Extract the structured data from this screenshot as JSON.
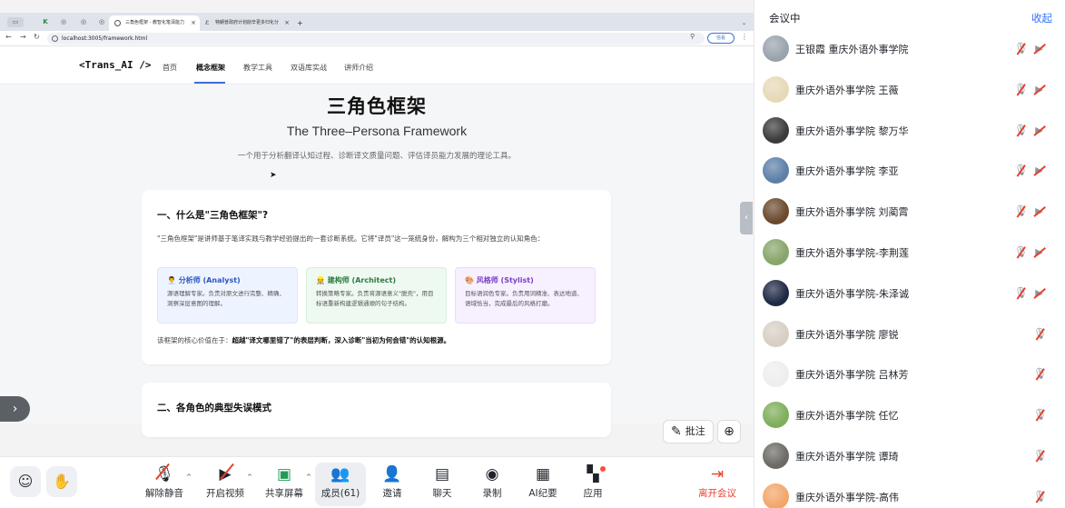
{
  "browser": {
    "tabs": [
      {
        "label": "三角色框架 - 教智化笔译能力",
        "active": true
      },
      {
        "label": "特朗普政府计划削辛更多归化分",
        "active": false
      }
    ],
    "url": "localhost:3005/framework.html",
    "sync_label": "信看"
  },
  "site": {
    "brand": "<Trans_AI />",
    "nav": [
      {
        "label": "首页",
        "active": false
      },
      {
        "label": "概念框架",
        "active": true
      },
      {
        "label": "教学工具",
        "active": false
      },
      {
        "label": "双语库实战",
        "active": false
      },
      {
        "label": "讲师介绍",
        "active": false
      }
    ],
    "hero_title": "三角色框架",
    "hero_subtitle": "The Three–Persona Framework",
    "hero_desc": "一个用于分析翻译认知过程、诊断译文质量问题、评估译员能力发展的理论工具。",
    "section1": {
      "heading": "一、什么是\"三角色框架\"?",
      "paragraph": "\"三角色框架\"是讲师基于笔译实践与教学经验提出的一套诊断系统。它将\"译员\"这一笼统身份，解构为三个相对独立的认知角色：",
      "roles": [
        {
          "name": "分析师 (Analyst)",
          "desc": "源语理解专家。负责对原文进行完整、精确、洞察深层意图的理解。",
          "icon": "👨‍💼"
        },
        {
          "name": "建构师 (Architect)",
          "desc": "转换策略专家。负责将源语意义\"脱壳\"，用目标语重新构建逻辑通顺的句子结构。",
          "icon": "👷"
        },
        {
          "name": "风格师 (Stylist)",
          "desc": "目标语润色专家。负责用词精准、表达地道、语域恰当，完成最后的风格打磨。",
          "icon": "🎨"
        }
      ],
      "footer_prefix": "该框架的核心价值在于：",
      "footer_bold": "超越\"译文哪里错了\"的表层判断，深入诊断\"当初为何会错\"的认知根源。"
    },
    "section2": {
      "heading": "二、各角色的典型失误模式"
    }
  },
  "overlay": {
    "annotate_label": "批注"
  },
  "toolbar": {
    "items": [
      {
        "key": "mute",
        "label": "解除静音",
        "caret": true
      },
      {
        "key": "video",
        "label": "开启视频",
        "caret": true
      },
      {
        "key": "share",
        "label": "共享屏幕",
        "caret": true
      },
      {
        "key": "members",
        "label": "成员(61)",
        "caret": false
      },
      {
        "key": "invite",
        "label": "邀请",
        "caret": false
      },
      {
        "key": "chat",
        "label": "聊天",
        "caret": false
      },
      {
        "key": "record",
        "label": "录制",
        "caret": false
      },
      {
        "key": "ai",
        "label": "AI纪要",
        "caret": false
      },
      {
        "key": "apps",
        "label": "应用",
        "caret": false
      },
      {
        "key": "leave",
        "label": "离开会议",
        "caret": false
      }
    ]
  },
  "panel": {
    "title": "会议中",
    "collapse_label": "收起",
    "participants": [
      {
        "name": "王银霞  重庆外语外事学院",
        "cam": true,
        "avatar_color": "#9aa3ad"
      },
      {
        "name": "重庆外语外事学院 王薇",
        "cam": true,
        "avatar_color": "#e7d9b8"
      },
      {
        "name": "重庆外语外事学院 黎万华",
        "cam": true,
        "avatar_color": "#3b3b3b"
      },
      {
        "name": "重庆外语外事学院 李亚",
        "cam": true,
        "avatar_color": "#5d7fa8"
      },
      {
        "name": "重庆外语外事学院 刘蔺霄",
        "cam": true,
        "avatar_color": "#6b4a2f"
      },
      {
        "name": "重庆外语外事学院-李荆莲",
        "cam": true,
        "avatar_color": "#88a56b"
      },
      {
        "name": "重庆外语外事学院-朱泽诚",
        "cam": true,
        "avatar_color": "#1f2a44"
      },
      {
        "name": "重庆外语外事学院 廖锐",
        "cam": false,
        "avatar_color": "#d8cfc4"
      },
      {
        "name": "重庆外语外事学院 吕林芳",
        "cam": false,
        "avatar_color": "#eeeeee"
      },
      {
        "name": "重庆外语外事学院 任忆",
        "cam": false,
        "avatar_color": "#7fae5a"
      },
      {
        "name": "重庆外语外事学院 谭琦",
        "cam": false,
        "avatar_color": "#6d6a66"
      },
      {
        "name": "重庆外语外事学院-高伟",
        "cam": false,
        "avatar_color": "#f2a66a"
      }
    ]
  },
  "colors": {
    "accent": "#3370ff",
    "danger": "#e5412e"
  }
}
